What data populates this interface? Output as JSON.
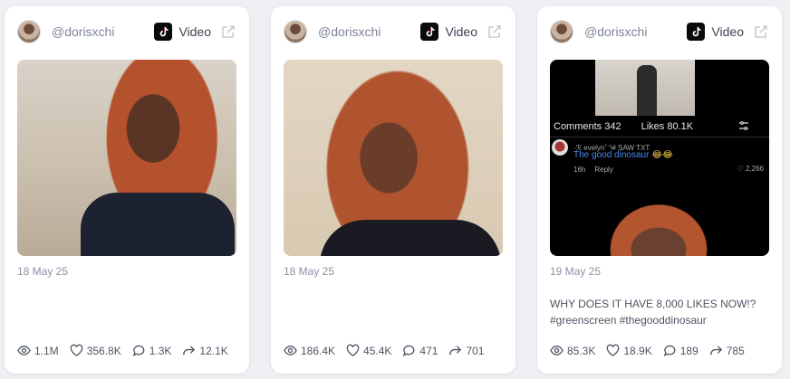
{
  "cards": [
    {
      "handle": "@dorisxchi",
      "type_label": "Video",
      "date": "18 May 25",
      "caption": "",
      "stats": {
        "views": "1.1M",
        "likes": "356.8K",
        "comments": "1.3K",
        "shares": "12.1K"
      }
    },
    {
      "handle": "@dorisxchi",
      "type_label": "Video",
      "date": "18 May 25",
      "caption": "",
      "stats": {
        "views": "186.4K",
        "likes": "45.4K",
        "comments": "471",
        "shares": "701"
      }
    },
    {
      "handle": "@dorisxchi",
      "type_label": "Video",
      "date": "19 May 25",
      "caption": "WHY DOES IT HAVE 8,000 LIKES NOW!? #greenscreen #thegooddinosaur",
      "stats": {
        "views": "85.3K",
        "likes": "18.9K",
        "comments": "189",
        "shares": "785"
      },
      "thumb_overlay": {
        "comments_label": "Comments 342",
        "likes_label": "Likes 80.1K",
        "comment_user": "·ℛ evelyn˚ˑ༄ SAW TXT",
        "comment_text": "The good dinosaur",
        "comment_emoji": "😂😂",
        "comment_age": "16h",
        "reply_label": "Reply",
        "comment_likes": "2,266"
      }
    }
  ],
  "icons": {
    "platform": "tiktok-icon",
    "external": "external-link-icon",
    "views": "eye-icon",
    "likes": "heart-icon",
    "comments": "comment-icon",
    "shares": "share-icon"
  },
  "colors": {
    "background": "#eef0f4",
    "card": "#ffffff",
    "muted_text": "#8a93a2",
    "body_text": "#4d5563"
  }
}
